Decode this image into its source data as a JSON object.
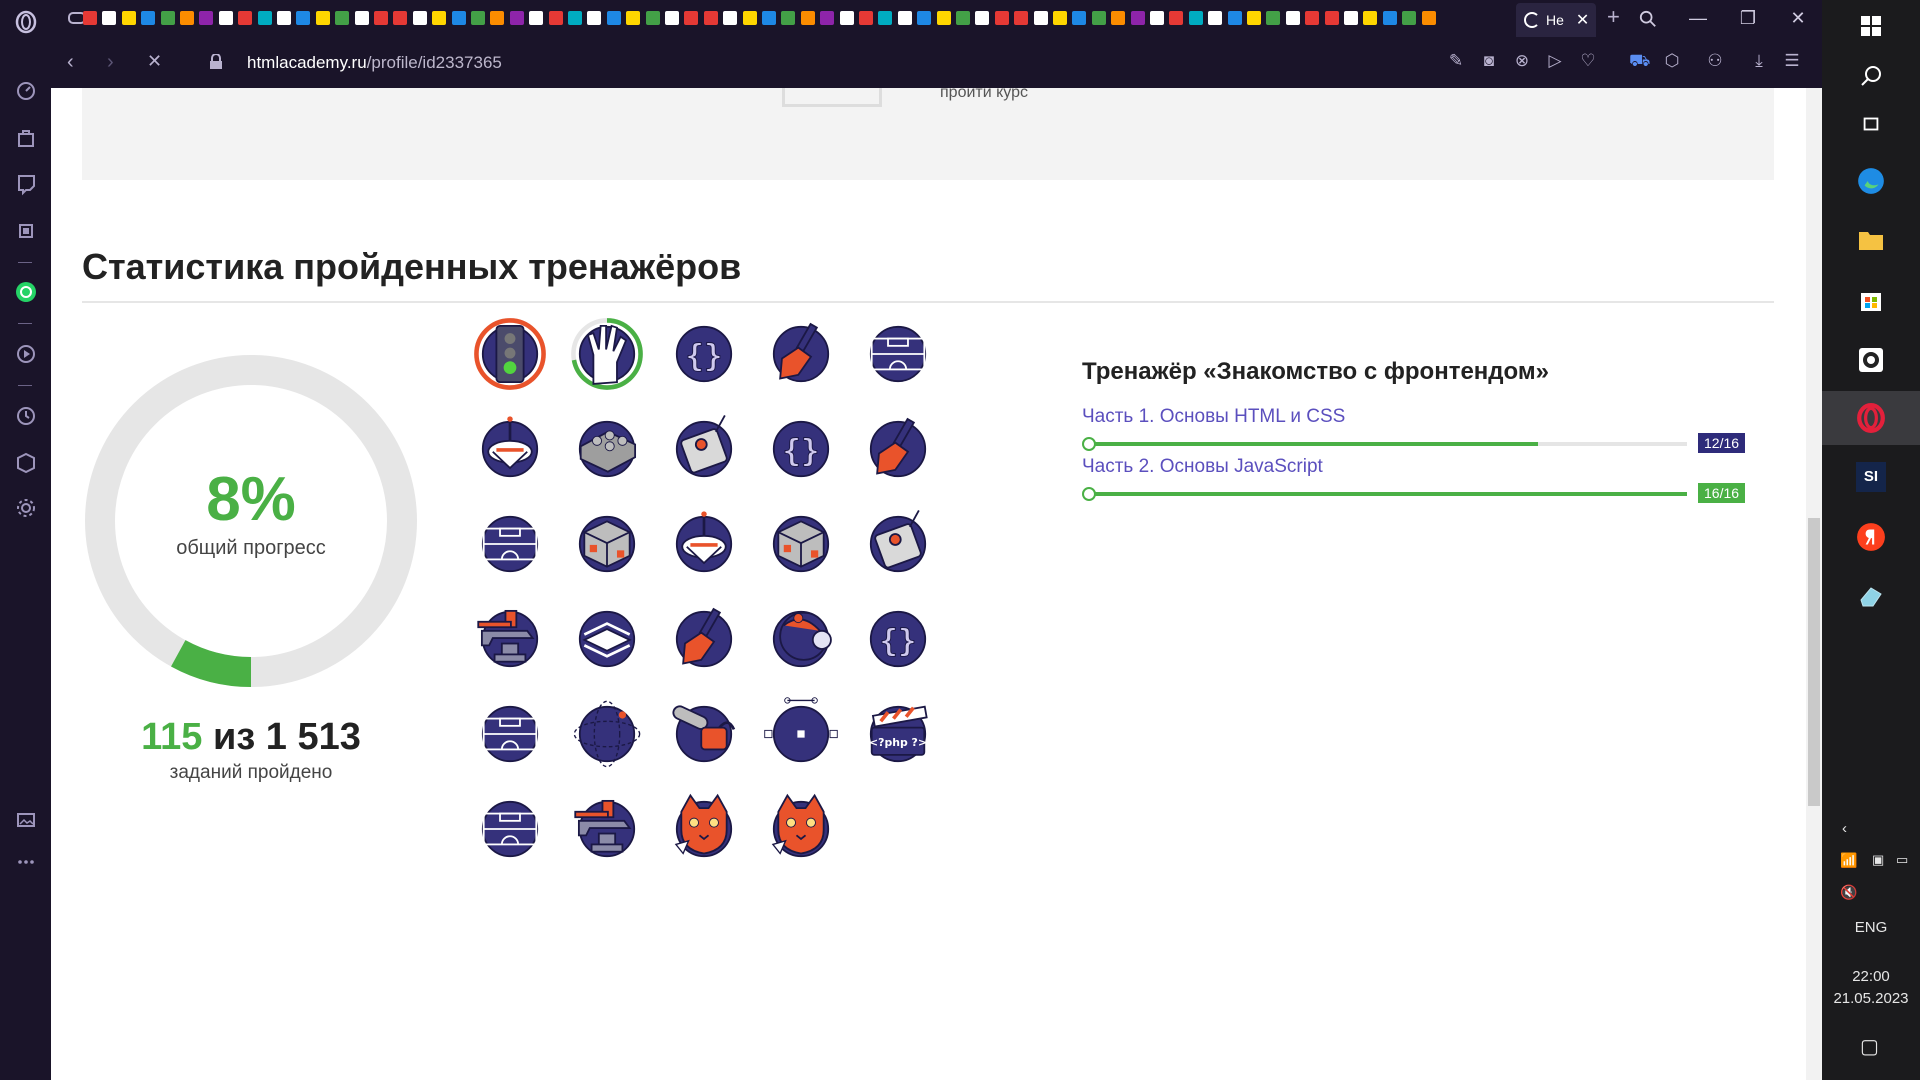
{
  "browser": {
    "active_tab_title": "Не",
    "url_domain": "htmlacademy.ru",
    "url_path": "/profile/id2337365"
  },
  "page": {
    "course_cta": "пройти курс",
    "heading": "Статистика пройденных тренажёров",
    "progress": {
      "percent_label": "8%",
      "percent_caption": "общий прогресс",
      "completed": "115",
      "between": " из ",
      "total": "1 513",
      "count_caption": "заданий пройдено",
      "fill_fraction": 0.08
    },
    "badges": [
      "traffic-light-badge",
      "vulcan-hand-badge",
      "braces-badge",
      "brush-badge",
      "stadium-badge",
      "spinning-top-badge",
      "lego-brick-badge",
      "remote-control-badge",
      "braces-badge",
      "brush-badge",
      "stadium-badge",
      "rubiks-cube-badge",
      "spinning-top-badge",
      "rubiks-cube-badge",
      "remote-control-badge",
      "anvil-badge",
      "layers-badge",
      "brush-badge",
      "robot-vacuum-badge",
      "braces-badge",
      "stadium-badge",
      "sphere-badge",
      "chainsaw-badge",
      "vector-path-badge",
      "php-clapper-badge",
      "stadium-badge",
      "anvil-badge",
      "cat-badge",
      "cat-badge"
    ],
    "trainer": {
      "title": "Тренажёр «Знакомство с фронтендом»",
      "parts": [
        {
          "label": "Часть 1. Основы HTML и CSS",
          "progress": "12/16",
          "fraction": 0.75,
          "badge_color": "#2e2b7a"
        },
        {
          "label": "Часть 2. Основы JavaScript",
          "progress": "16/16",
          "fraction": 1.0,
          "badge_color": "#4ab045"
        }
      ]
    }
  },
  "taskbar": {
    "language": "ENG",
    "time": "22:00",
    "date": "21.05.2023",
    "game_label": "SI"
  },
  "colors": {
    "accent_green": "#4ab045",
    "accent_purple": "#2e2b7a",
    "badge_navy": "#35317b"
  }
}
